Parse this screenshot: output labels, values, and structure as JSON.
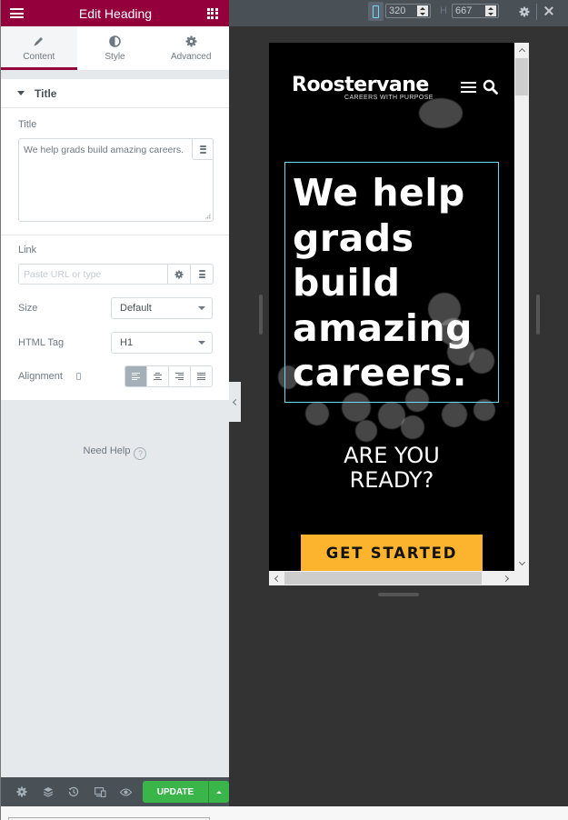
{
  "panel": {
    "header_title": "Edit Heading",
    "tabs": [
      {
        "label": "Content",
        "icon": "pencil-icon",
        "active": true
      },
      {
        "label": "Style",
        "icon": "half-circle-icon",
        "active": false
      },
      {
        "label": "Advanced",
        "icon": "gear-icon",
        "active": false
      }
    ],
    "section_title": "Title",
    "title_label": "Title",
    "title_value": "We help grads build amazing careers.",
    "link_label": "Link",
    "link_placeholder": "Paste URL or type",
    "size_label": "Size",
    "size_value": "Default",
    "html_tag_label": "HTML Tag",
    "html_tag_value": "H1",
    "alignment_label": "Alignment",
    "alignment_options": [
      "left",
      "center",
      "right",
      "justify"
    ],
    "alignment_selected": "left",
    "need_help": "Need Help",
    "footer": {
      "icons": [
        "settings-icon",
        "navigator-layers-icon",
        "history-icon",
        "responsive-mode-icon",
        "preview-eye-icon"
      ],
      "update_label": "UPDATE"
    },
    "accent_color": "#93003c",
    "update_color": "#39b54a"
  },
  "toolbar": {
    "device": "mobile",
    "width_value": "320",
    "height_label": "H",
    "height_value": "667"
  },
  "preview": {
    "logo": "Roostervane",
    "tagline": "CAREERS WITH PURPOSE",
    "heading": "We help grads build amazing careers.",
    "subheading_line1": "ARE YOU",
    "subheading_line2": "READY?",
    "cta_label": "GET STARTED",
    "cta_color": "#fcb42f",
    "selection_color": "#71d7f7"
  }
}
